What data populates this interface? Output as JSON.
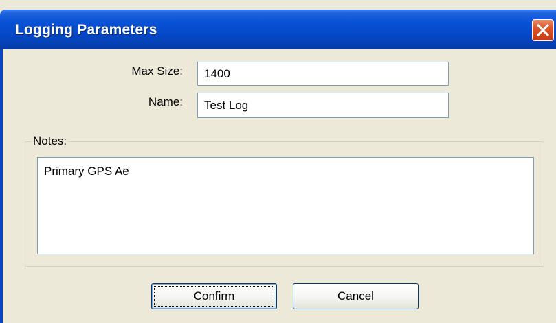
{
  "window": {
    "title": "Logging Parameters",
    "close_icon": "close-icon"
  },
  "fields": {
    "max_size_label": "Max Size:",
    "max_size_value": "1400",
    "name_label": "Name:",
    "name_value": "Test Log"
  },
  "notes": {
    "group_label": "Notes:",
    "value": "Primary GPS Ae"
  },
  "buttons": {
    "confirm_label": "Confirm",
    "cancel_label": "Cancel"
  },
  "colors": {
    "titlebar": "#0449c9",
    "dialog_bg": "#ece9d8",
    "close_button": "#d9562a",
    "field_border": "#7f9db9",
    "button_border": "#003c74"
  }
}
